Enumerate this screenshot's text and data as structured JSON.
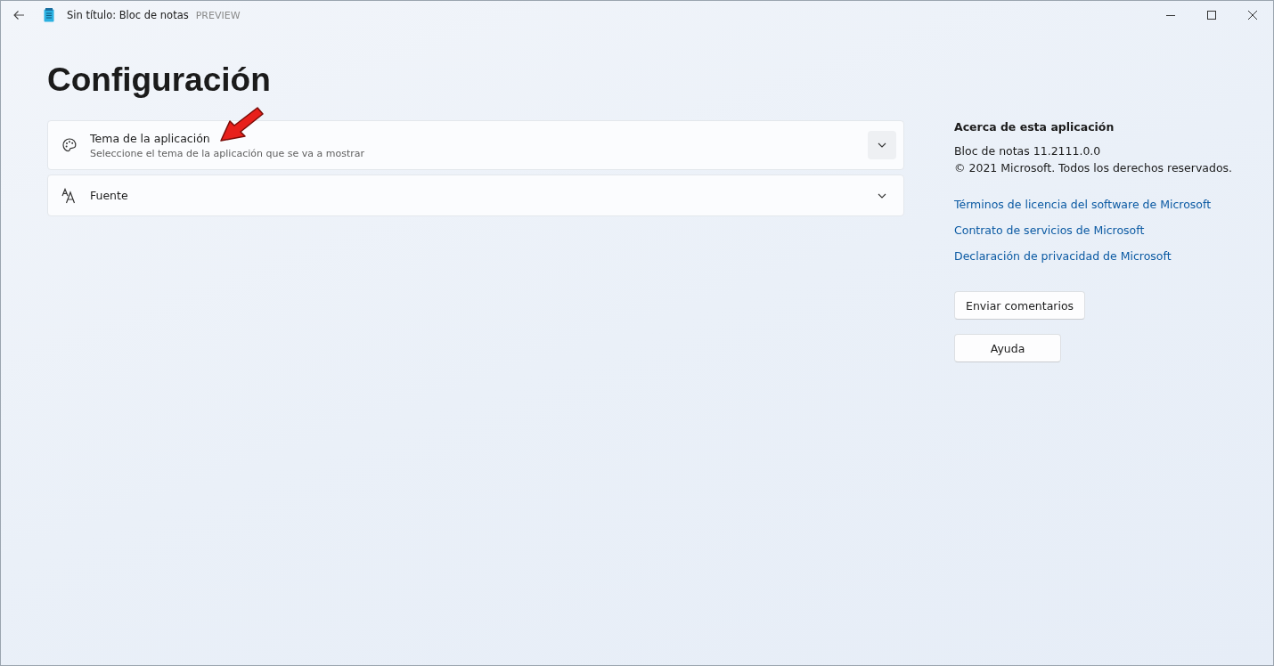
{
  "window": {
    "title": "Sin título: Bloc de notas",
    "badge": "PREVIEW"
  },
  "heading": "Configuración",
  "settings": [
    {
      "kind": "theme",
      "label": "Tema de la aplicación",
      "description": "Seleccione el tema de la aplicación que se va a mostrar",
      "highlighted": true
    },
    {
      "kind": "font",
      "label": "Fuente",
      "highlighted": false
    }
  ],
  "about": {
    "title": "Acerca de esta aplicación",
    "lines": [
      "Bloc de notas 11.2111.0.0",
      "© 2021 Microsoft. Todos los derechos reservados."
    ],
    "links": [
      "Términos de licencia del software de Microsoft",
      "Contrato de servicios de Microsoft",
      "Declaración de privacidad de Microsoft"
    ],
    "buttons": [
      "Enviar comentarios",
      "Ayuda"
    ]
  }
}
